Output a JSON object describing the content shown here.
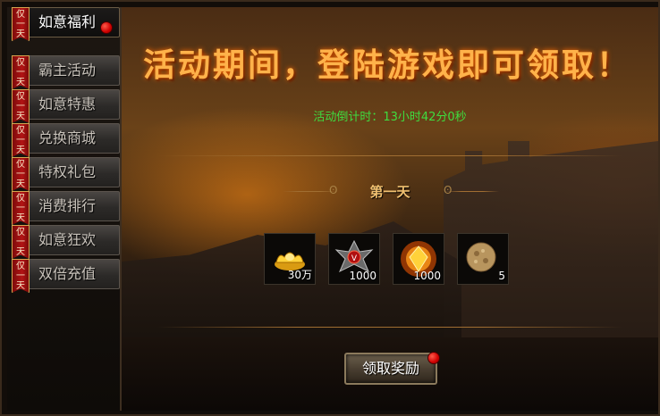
{
  "sidebar": {
    "ribbon_text": "仅一天",
    "items": [
      {
        "label": "如意福利",
        "active": true,
        "has_dot": true
      },
      {
        "label": "霸主活动",
        "active": false
      },
      {
        "label": "如意特惠",
        "active": false
      },
      {
        "label": "兑换商城",
        "active": false
      },
      {
        "label": "特权礼包",
        "active": false
      },
      {
        "label": "消费排行",
        "active": false
      },
      {
        "label": "如意狂欢",
        "active": false
      },
      {
        "label": "双倍充值",
        "active": false
      }
    ]
  },
  "main": {
    "headline": "活动期间，登陆游戏即可领取！",
    "countdown_label": "活动倒计时：",
    "countdown_value": "13小时42分0秒",
    "day_title": "第一天",
    "rewards": [
      {
        "icon": "gold-ingot-icon",
        "qty": "30万"
      },
      {
        "icon": "demon-emblem-icon",
        "qty": "1000"
      },
      {
        "icon": "fire-gem-icon",
        "qty": "1000"
      },
      {
        "icon": "stone-orb-icon",
        "qty": "5"
      }
    ],
    "claim_button": "领取奖励"
  },
  "colors": {
    "headline": "#ffb24a",
    "countdown": "#3fdc3f",
    "ribbon": "#b21414",
    "notify_dot": "#d00000"
  }
}
